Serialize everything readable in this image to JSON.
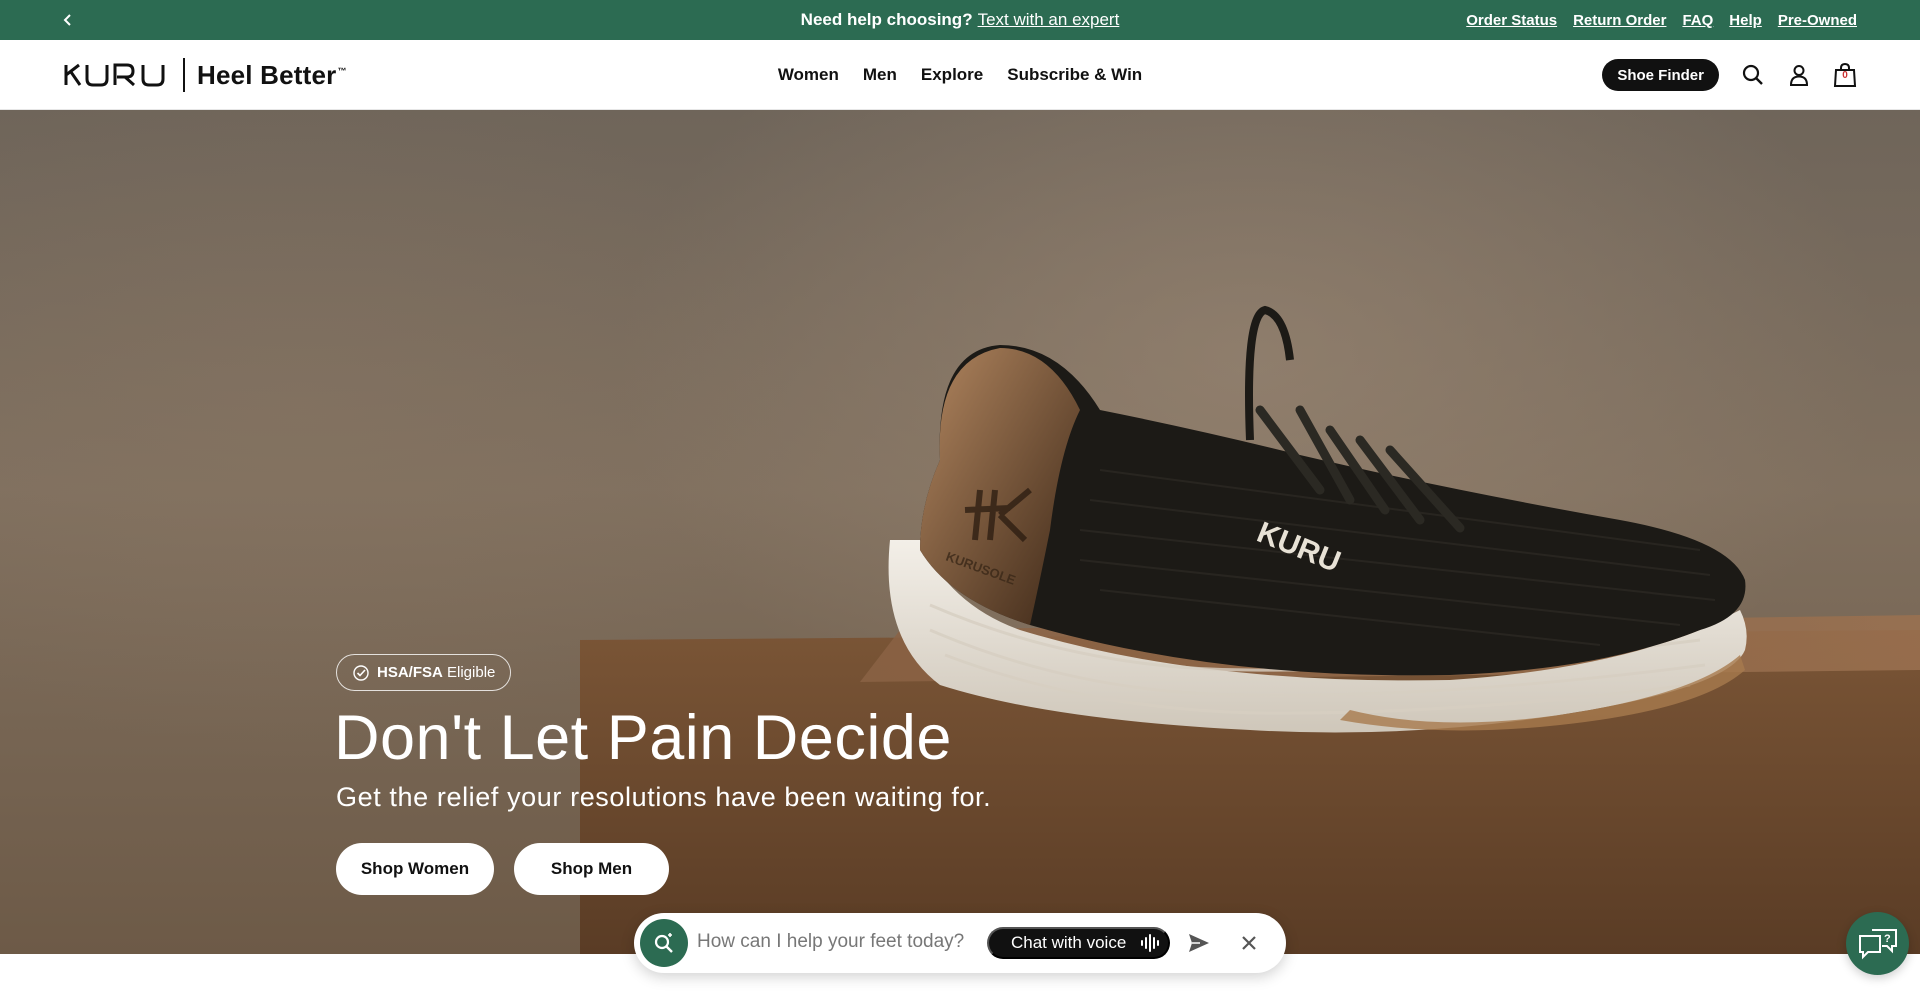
{
  "announcement": {
    "lead": "Need help choosing?",
    "link": "Text with an expert",
    "utility_links": [
      "Order Status",
      "Return Order",
      "FAQ",
      "Help",
      "Pre-Owned"
    ],
    "prev_icon": "chevron-left-icon",
    "bg_color": "#2c6b52"
  },
  "header": {
    "brand": "KURU",
    "tagline": "Heel Better",
    "tagline_mark": "™",
    "nav": [
      "Women",
      "Men",
      "Explore",
      "Subscribe & Win"
    ],
    "shoe_finder": "Shoe Finder",
    "icons": [
      "search-icon",
      "account-icon",
      "bag-icon"
    ],
    "bag_count": "0"
  },
  "hero": {
    "badge_bold": "HSA/FSA",
    "badge_text": "Eligible",
    "title": "Don't Let Pain Decide",
    "subtitle": "Get the relief your resolutions have been waiting for.",
    "cta_women": "Shop Women",
    "cta_men": "Shop Men",
    "shoe_brand": "KURU",
    "shoe_sole_text": "KURUSOLE"
  },
  "chat": {
    "placeholder": "How can I help your feet today?",
    "voice_label": "Chat with voice",
    "icons": [
      "search-sparkle-icon",
      "voice-wave-icon",
      "send-icon",
      "close-icon"
    ]
  },
  "help_fab": {
    "icon": "chat-help-icon"
  }
}
